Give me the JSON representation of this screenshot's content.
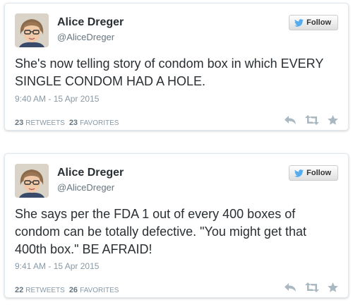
{
  "tweets": [
    {
      "author_name": "Alice Dreger",
      "author_handle": "@AliceDreger",
      "follow_label": "Follow",
      "text": "She's now telling story of condom box in which EVERY SINGLE CONDOM HAD A HOLE.",
      "timestamp": "9:40 AM - 15 Apr 2015",
      "retweets_count": "23",
      "retweets_label": "RETWEETS",
      "favorites_count": "23",
      "favorites_label": "FAVORITES"
    },
    {
      "author_name": "Alice Dreger",
      "author_handle": "@AliceDreger",
      "follow_label": "Follow",
      "text": "She says per the FDA 1 out of every 400 boxes of condom can be totally defective. \"You might get that 400th box.\" BE AFRAID!",
      "timestamp": "9:41 AM - 15 Apr 2015",
      "retweets_count": "22",
      "retweets_label": "RETWEETS",
      "favorites_count": "26",
      "favorites_label": "FAVORITES"
    }
  ],
  "icons": {
    "follow": "twitter-bird-icon",
    "reply": "reply-icon",
    "retweet": "retweet-icon",
    "favorite": "star-icon"
  },
  "colors": {
    "twitter_blue": "#55acee",
    "text": "#292f33",
    "muted": "#8899a6",
    "action_icon": "#aab8c2",
    "border": "#e1e8ed"
  }
}
